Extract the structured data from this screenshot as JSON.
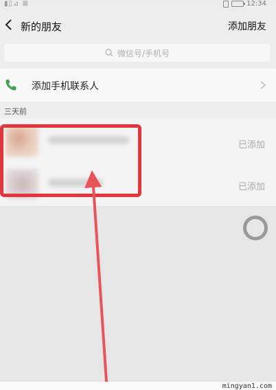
{
  "status_bar": {
    "time": "12:34",
    "left_glyphs": "▮▯⊿ ⊠"
  },
  "nav": {
    "title": "新的朋友",
    "action": "添加朋友"
  },
  "search": {
    "placeholder": "微信号/手机号"
  },
  "phone_contacts": {
    "label": "添加手机联系人"
  },
  "section": {
    "header": "三天前"
  },
  "friends": [
    {
      "status": "已添加"
    },
    {
      "status": "已添加"
    }
  ],
  "colors": {
    "highlight": "#e4353d",
    "arrow": "#e8545a",
    "phone_green": "#3fa34d"
  },
  "watermark": "mingyan1.com"
}
